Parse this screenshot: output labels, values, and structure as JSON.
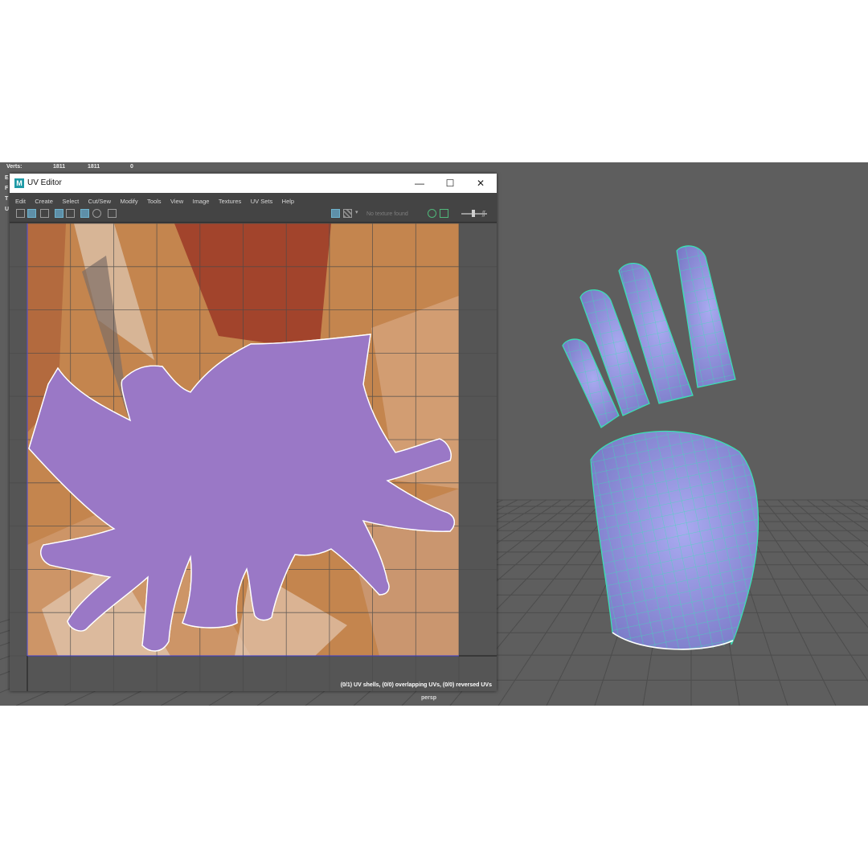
{
  "hud": {
    "verts_label": "Verts:",
    "verts_values": [
      "1811",
      "1811",
      "0"
    ],
    "side_letters": [
      "E",
      "F",
      "T",
      "U"
    ]
  },
  "viewport": {
    "camera": "persp",
    "mesh_color": "#8b8cd6",
    "wire_color": "#35e0b0"
  },
  "uv_editor": {
    "title": "UV Editor",
    "app_icon": "maya-logo-icon",
    "window_buttons": {
      "minimize": "—",
      "maximize": "☐",
      "close": "✕"
    },
    "menu": [
      "Edit",
      "Create",
      "Select",
      "Cut/Sew",
      "Modify",
      "Tools",
      "View",
      "Image",
      "Textures",
      "UV Sets",
      "Help"
    ],
    "toolbar": {
      "texture_status": "No texture found",
      "left_icons": [
        "grid-icon",
        "shaded-icon",
        "distortion-icon",
        "tile-icon",
        "checker-layout-icon",
        "pixel-snap-icon",
        "exposure-icon",
        "snapshot-icon"
      ],
      "right_icons": [
        "image-display-icon",
        "checker-icon",
        "dropdown-icon",
        "color-manage-icon",
        "gamma-icon",
        "slider-icon",
        "pin-icon"
      ]
    },
    "status": "(0/1) UV shells, (0/0) overlapping UVs, (0/0) reversed UVs",
    "uv_shell_color": "#9a78c6",
    "checker_colors": [
      "#c4854e",
      "#a2442c",
      "#d6a27c",
      "#7d6e67"
    ]
  }
}
